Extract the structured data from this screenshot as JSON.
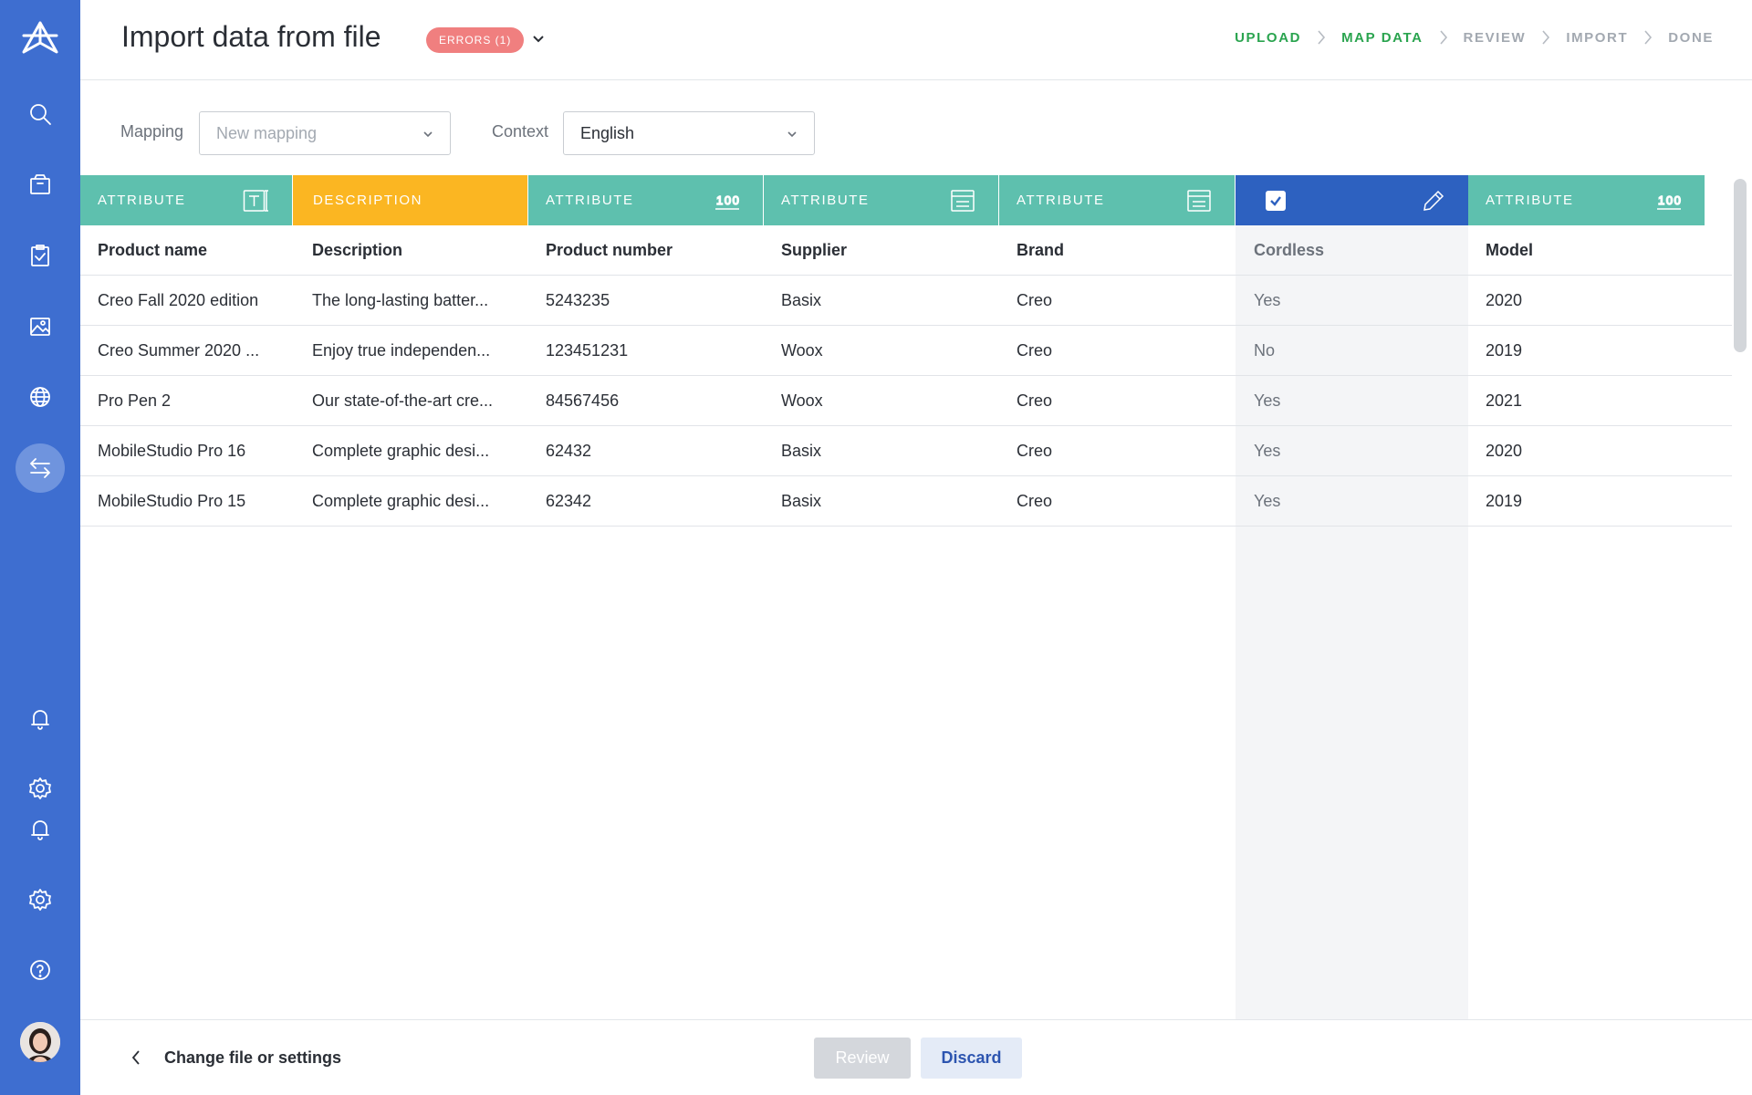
{
  "colors": {
    "sidebar": "#3e6ed0",
    "teal": "#5ec0ae",
    "yellow": "#fbb622",
    "blue": "#2d61c0",
    "error": "#f07f7f",
    "step_done": "#2aa44f"
  },
  "header": {
    "title": "Import data from file",
    "errors_badge": "ERRORS (1)",
    "steps": [
      {
        "label": "UPLOAD",
        "state": "done"
      },
      {
        "label": "MAP DATA",
        "state": "done"
      },
      {
        "label": "REVIEW",
        "state": "pending"
      },
      {
        "label": "IMPORT",
        "state": "pending"
      },
      {
        "label": "DONE",
        "state": "pending"
      }
    ]
  },
  "sidebar": {
    "items": [
      {
        "icon": "logo-icon"
      },
      {
        "icon": "search-icon"
      },
      {
        "icon": "package-icon"
      },
      {
        "icon": "clipboard-check-icon"
      },
      {
        "icon": "image-icon"
      },
      {
        "icon": "globe-icon"
      },
      {
        "icon": "import-export-icon",
        "active": true
      },
      {
        "icon": "bell-icon"
      },
      {
        "icon": "gear-icon"
      },
      {
        "icon": "bell-icon"
      },
      {
        "icon": "gear-icon"
      },
      {
        "icon": "help-icon"
      },
      {
        "icon": "user-avatar"
      }
    ]
  },
  "filters": {
    "mapping_label": "Mapping",
    "mapping_placeholder": "New mapping",
    "context_label": "Context",
    "context_value": "English"
  },
  "table": {
    "columns": [
      {
        "header": "ATTRIBUTE",
        "type": "teal",
        "icon": "text-field-icon",
        "field": "Product name"
      },
      {
        "header": "DESCRIPTION",
        "type": "yellow",
        "icon": "",
        "field": "Description"
      },
      {
        "header": "ATTRIBUTE",
        "type": "teal",
        "icon": "number-icon",
        "icon_text": "100",
        "field": "Product number"
      },
      {
        "header": "ATTRIBUTE",
        "type": "teal",
        "icon": "list-icon",
        "field": "Supplier"
      },
      {
        "header": "ATTRIBUTE",
        "type": "teal",
        "icon": "list-icon",
        "field": "Brand"
      },
      {
        "header": "",
        "type": "blue",
        "icon": "pencil-icon",
        "checked": true,
        "field": "Cordless"
      },
      {
        "header": "ATTRIBUTE",
        "type": "teal",
        "icon": "number-icon",
        "icon_text": "100",
        "field": "Model"
      }
    ],
    "rows": [
      [
        "Creo Fall 2020 edition",
        "The long-lasting batter...",
        "5243235",
        "Basix",
        "Creo",
        "Yes",
        "2020"
      ],
      [
        "Creo Summer 2020 ...",
        "Enjoy true independen...",
        "123451231",
        "Woox",
        "Creo",
        "No",
        "2019"
      ],
      [
        "Pro Pen 2",
        "Our state-of-the-art cre...",
        "84567456",
        "Woox",
        "Creo",
        "Yes",
        "2021"
      ],
      [
        "MobileStudio Pro 16",
        "Complete graphic desi...",
        "62432",
        "Basix",
        "Creo",
        "Yes",
        "2020"
      ],
      [
        "MobileStudio Pro 15",
        "Complete graphic desi...",
        "62342",
        "Basix",
        "Creo",
        "Yes",
        "2019"
      ]
    ]
  },
  "footer": {
    "back_label": "Change file or settings",
    "review_label": "Review",
    "discard_label": "Discard"
  }
}
